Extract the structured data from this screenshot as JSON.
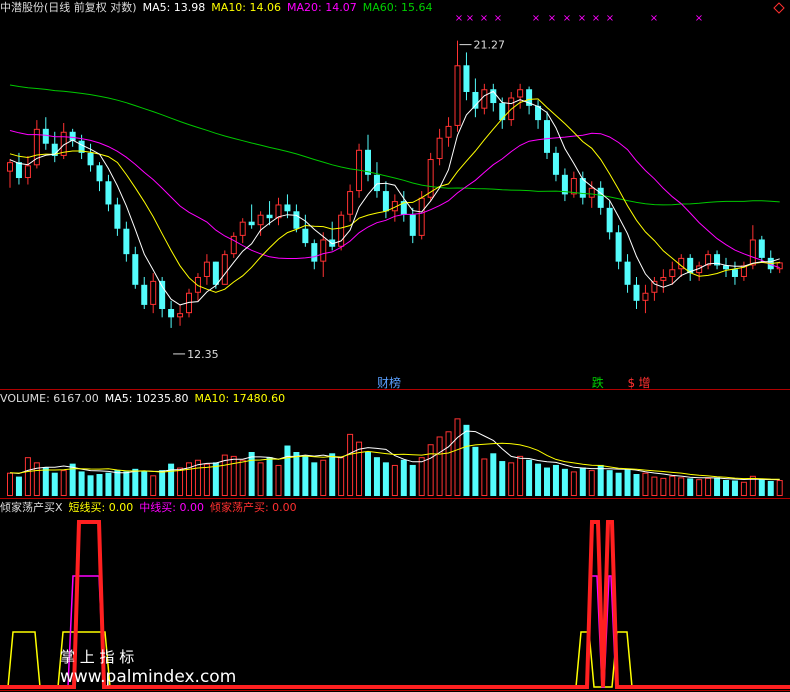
{
  "colors": {
    "background": "#000000",
    "up": "#ff3232",
    "down": "#54fcfc",
    "ma5": "#ffffff",
    "ma10": "#ffff00",
    "ma20": "#ff00ff",
    "ma60": "#00c800",
    "frame": "#b00000",
    "short_buy": "#ffff00",
    "mid_buy": "#ff00ff",
    "all_in_buy": "#ff2020"
  },
  "price_header": {
    "name": "中潜股份(日线 前复权 对数)",
    "ma5": "MA5: 13.98",
    "ma10": "MA10: 14.06",
    "ma20": "MA20: 14.07",
    "ma60": "MA60: 15.64"
  },
  "volume_header": {
    "volume": "VOLUME: 6167.00",
    "ma5": "MA5: 10235.80",
    "ma10": "MA10: 17480.60"
  },
  "indicator_header": {
    "name": "倾家荡产买X",
    "short": "短线买: 0.00",
    "mid": "中线买: 0.00",
    "all": "倾家荡产买: 0.00"
  },
  "annotations": {
    "high_label": "21.27",
    "low_label": "12.35",
    "event_1": "财榜",
    "event_2": "跌",
    "event_3": "$",
    "event_4": "增",
    "watermark_cn": "掌 上 指 标",
    "watermark_url": "www.palmindex.com"
  },
  "chart_data": [
    {
      "type": "candlestick",
      "scale": "log",
      "price_range": [
        11.8,
        22.2
      ],
      "high": 21.27,
      "low": 12.35,
      "ma5": 13.98,
      "ma10": 14.06,
      "ma20": 14.07,
      "ma60": 15.64,
      "bars": [
        [
          16.6,
          17.0,
          16.1,
          16.9
        ],
        [
          16.9,
          17.2,
          16.2,
          16.4
        ],
        [
          16.4,
          17.1,
          16.2,
          16.8
        ],
        [
          16.8,
          18.3,
          16.7,
          18.0
        ],
        [
          18.0,
          18.4,
          17.3,
          17.5
        ],
        [
          17.5,
          17.9,
          16.9,
          17.1
        ],
        [
          17.1,
          18.2,
          17.0,
          17.9
        ],
        [
          17.9,
          18.0,
          17.4,
          17.6
        ],
        [
          17.6,
          17.8,
          17.0,
          17.2
        ],
        [
          17.2,
          17.5,
          16.6,
          16.8
        ],
        [
          16.8,
          16.9,
          16.0,
          16.3
        ],
        [
          16.3,
          16.5,
          15.4,
          15.6
        ],
        [
          15.6,
          15.8,
          14.7,
          14.9
        ],
        [
          14.9,
          15.1,
          14.0,
          14.2
        ],
        [
          14.2,
          14.4,
          13.3,
          13.4
        ],
        [
          13.4,
          13.6,
          12.8,
          12.9
        ],
        [
          12.9,
          13.7,
          12.7,
          13.5
        ],
        [
          13.5,
          13.6,
          12.6,
          12.8
        ],
        [
          12.8,
          13.0,
          12.35,
          12.6
        ],
        [
          12.6,
          12.9,
          12.4,
          12.7
        ],
        [
          12.7,
          13.3,
          12.6,
          13.2
        ],
        [
          13.2,
          13.7,
          13.0,
          13.6
        ],
        [
          13.6,
          14.2,
          13.4,
          14.0
        ],
        [
          14.0,
          14.0,
          13.3,
          13.4
        ],
        [
          13.4,
          14.3,
          13.4,
          14.2
        ],
        [
          14.2,
          14.8,
          14.1,
          14.7
        ],
        [
          14.7,
          15.2,
          14.5,
          15.1
        ],
        [
          15.1,
          15.6,
          14.9,
          15.0
        ],
        [
          15.0,
          15.4,
          14.7,
          15.3
        ],
        [
          15.3,
          15.7,
          15.0,
          15.2
        ],
        [
          15.2,
          15.8,
          15.0,
          15.6
        ],
        [
          15.6,
          15.9,
          15.2,
          15.4
        ],
        [
          15.4,
          15.6,
          14.8,
          14.9
        ],
        [
          14.9,
          15.3,
          14.4,
          14.5
        ],
        [
          14.5,
          14.6,
          13.8,
          14.0
        ],
        [
          14.0,
          14.8,
          13.6,
          14.6
        ],
        [
          14.6,
          15.1,
          14.3,
          14.4
        ],
        [
          14.4,
          15.4,
          14.3,
          15.3
        ],
        [
          15.3,
          16.2,
          15.1,
          16.0
        ],
        [
          16.0,
          17.5,
          15.8,
          17.3
        ],
        [
          17.3,
          17.8,
          16.3,
          16.5
        ],
        [
          16.5,
          16.9,
          15.8,
          16.0
        ],
        [
          16.0,
          16.3,
          15.2,
          15.4
        ],
        [
          15.4,
          15.9,
          15.1,
          15.7
        ],
        [
          15.7,
          16.0,
          15.1,
          15.3
        ],
        [
          15.3,
          15.5,
          14.5,
          14.7
        ],
        [
          14.7,
          16.0,
          14.6,
          15.8
        ],
        [
          15.8,
          17.2,
          15.7,
          17.0
        ],
        [
          17.0,
          18.0,
          16.8,
          17.7
        ],
        [
          17.7,
          18.4,
          17.4,
          18.1
        ],
        [
          18.1,
          21.27,
          17.9,
          20.3
        ],
        [
          20.3,
          20.8,
          19.0,
          19.3
        ],
        [
          19.3,
          19.8,
          18.4,
          18.7
        ],
        [
          18.7,
          19.6,
          18.5,
          19.4
        ],
        [
          19.4,
          19.6,
          18.6,
          18.9
        ],
        [
          18.9,
          19.1,
          18.0,
          18.3
        ],
        [
          18.3,
          19.3,
          18.1,
          19.1
        ],
        [
          19.1,
          19.6,
          18.7,
          19.4
        ],
        [
          19.4,
          19.5,
          18.5,
          18.8
        ],
        [
          18.8,
          19.0,
          18.0,
          18.3
        ],
        [
          18.3,
          18.6,
          17.0,
          17.2
        ],
        [
          17.2,
          17.4,
          16.3,
          16.5
        ],
        [
          16.5,
          16.7,
          15.7,
          15.9
        ],
        [
          15.9,
          16.6,
          15.8,
          16.4
        ],
        [
          16.4,
          16.6,
          15.6,
          15.8
        ],
        [
          15.8,
          16.3,
          15.5,
          16.1
        ],
        [
          16.1,
          16.3,
          15.3,
          15.5
        ],
        [
          15.5,
          15.7,
          14.6,
          14.8
        ],
        [
          14.8,
          15.0,
          13.8,
          14.0
        ],
        [
          14.0,
          14.2,
          13.2,
          13.4
        ],
        [
          13.4,
          13.6,
          12.8,
          13.0
        ],
        [
          13.0,
          13.4,
          12.7,
          13.2
        ],
        [
          13.2,
          13.6,
          13.0,
          13.5
        ],
        [
          13.5,
          13.8,
          13.2,
          13.6
        ],
        [
          13.6,
          14.0,
          13.4,
          13.8
        ],
        [
          13.8,
          14.2,
          13.6,
          14.1
        ],
        [
          14.1,
          14.2,
          13.5,
          13.7
        ],
        [
          13.7,
          14.0,
          13.5,
          13.9
        ],
        [
          13.9,
          14.3,
          13.8,
          14.2
        ],
        [
          14.2,
          14.3,
          13.8,
          13.9
        ],
        [
          13.9,
          14.1,
          13.6,
          13.8
        ],
        [
          13.8,
          14.0,
          13.4,
          13.6
        ],
        [
          13.6,
          14.0,
          13.5,
          13.9
        ],
        [
          13.9,
          15.0,
          13.8,
          14.6
        ],
        [
          14.6,
          14.7,
          14.0,
          14.1
        ],
        [
          14.1,
          14.3,
          13.7,
          13.8
        ],
        [
          13.8,
          14.0,
          13.7,
          13.98
        ]
      ]
    },
    {
      "type": "bar",
      "series": "volume",
      "volume": 6167.0,
      "ma5": 10235.8,
      "ma10": 17480.6,
      "values": [
        9000,
        7500,
        15000,
        13000,
        11000,
        9000,
        10000,
        12500,
        9500,
        8000,
        8500,
        9000,
        10000,
        9500,
        10500,
        9500,
        8000,
        10000,
        12500,
        11000,
        13000,
        14000,
        12500,
        13000,
        16000,
        15500,
        14000,
        17000,
        13000,
        15000,
        12000,
        19500,
        17000,
        15500,
        13000,
        14000,
        16500,
        15000,
        24000,
        21000,
        17000,
        15000,
        13000,
        12000,
        14000,
        12000,
        15000,
        20000,
        23000,
        25000,
        30000,
        27500,
        19000,
        14500,
        16500,
        13500,
        13000,
        15500,
        14000,
        12500,
        11000,
        12000,
        10500,
        9500,
        11000,
        10000,
        12000,
        10000,
        9000,
        10500,
        8500,
        9000,
        7500,
        7000,
        7800,
        7200,
        6800,
        6500,
        7000,
        7200,
        6200,
        6000,
        5500,
        7800,
        6500,
        5800,
        6167
      ],
      "up": [
        1,
        0,
        1,
        1,
        0,
        0,
        1,
        0,
        0,
        0,
        0,
        0,
        0,
        0,
        0,
        0,
        1,
        0,
        0,
        1,
        1,
        1,
        1,
        0,
        1,
        1,
        1,
        0,
        1,
        0,
        1,
        0,
        0,
        0,
        0,
        1,
        0,
        1,
        1,
        1,
        0,
        0,
        0,
        1,
        0,
        0,
        1,
        1,
        1,
        1,
        1,
        0,
        0,
        1,
        0,
        0,
        1,
        1,
        0,
        0,
        0,
        0,
        0,
        1,
        0,
        1,
        0,
        0,
        0,
        0,
        0,
        1,
        1,
        1,
        1,
        1,
        0,
        1,
        1,
        0,
        0,
        0,
        1,
        1,
        0,
        0,
        1
      ],
      "ylim": [
        0,
        34000
      ]
    },
    {
      "type": "line",
      "series": [
        "短线买",
        "中线买",
        "倾家荡产买"
      ],
      "values": [
        0.0,
        0.0,
        0.0
      ]
    }
  ]
}
